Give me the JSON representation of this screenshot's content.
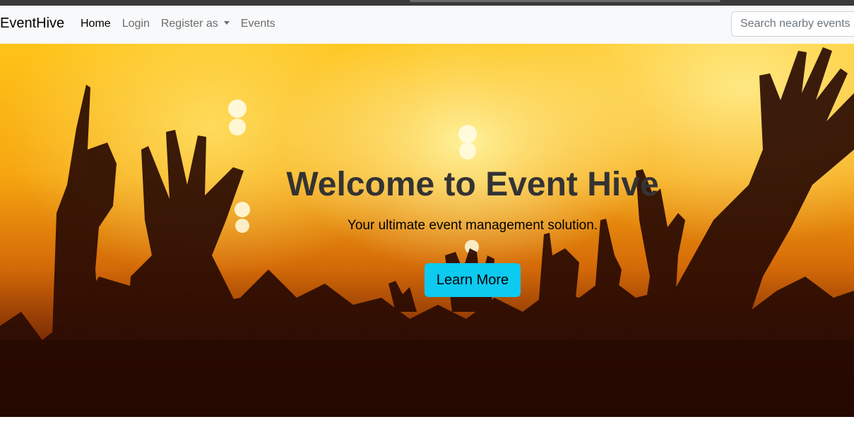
{
  "navbar": {
    "brand": "EventHive",
    "links": [
      {
        "label": "Home",
        "active": true
      },
      {
        "label": "Login",
        "active": false
      },
      {
        "label": "Register as",
        "active": false,
        "dropdown": true
      },
      {
        "label": "Events",
        "active": false
      }
    ],
    "search_placeholder": "Search nearby events"
  },
  "hero": {
    "title": "Welcome to Event Hive",
    "subtitle": "Your ultimate event management solution.",
    "cta_label": "Learn More",
    "cta_color": "#0dcaf0"
  },
  "colors": {
    "navbar_bg": "#f8f9fa",
    "hero_glow": "#ffc41a",
    "crowd_silhouette": "#2a0b03"
  },
  "icons": [
    "dropdown-caret-icon"
  ]
}
